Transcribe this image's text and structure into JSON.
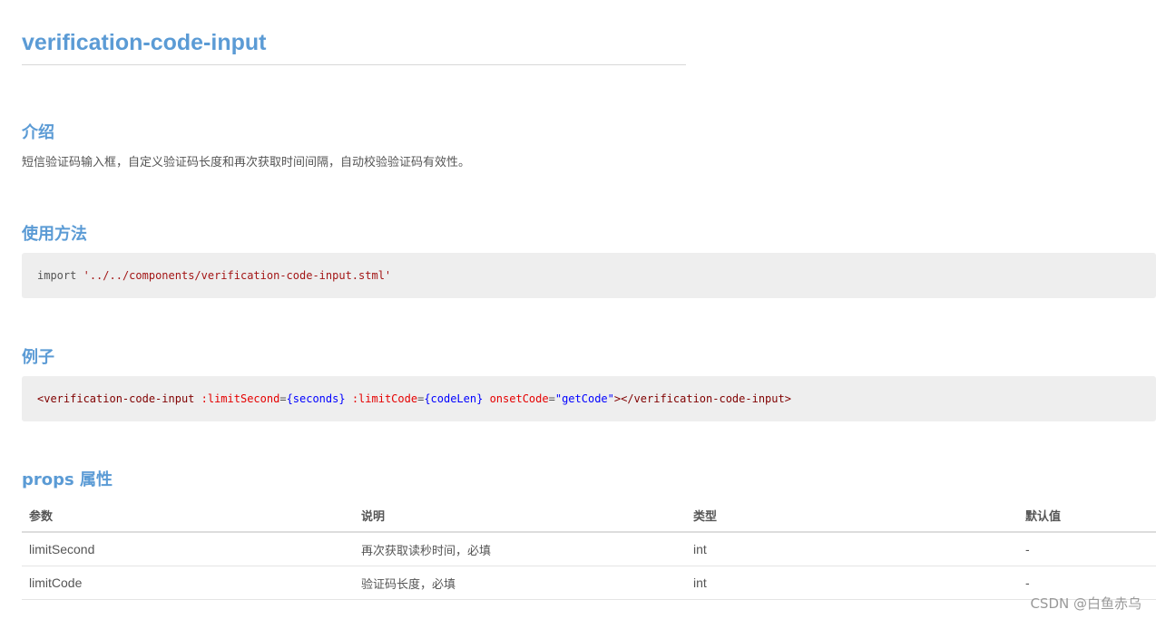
{
  "page": {
    "title": "verification-code-input"
  },
  "intro": {
    "heading": "介绍",
    "text": "短信验证码输入框，自定义验证码长度和再次获取时间间隔，自动校验验证码有效性。"
  },
  "usage": {
    "heading": "使用方法",
    "code_keyword": "import",
    "code_string": "'../../components/verification-code-input.stml'"
  },
  "example": {
    "heading": "例子",
    "open_tag": "<verification-code-input",
    "attr1_name": ":limitSecond",
    "attr1_value": "{seconds}",
    "attr2_name": ":limitCode",
    "attr2_value": "{codeLen}",
    "attr3_name": "onsetCode",
    "attr3_value": "\"getCode\"",
    "close_tag": "></verification-code-input>"
  },
  "props": {
    "heading": "props 属性",
    "columns": [
      "参数",
      "说明",
      "类型",
      "默认值"
    ],
    "rows": [
      [
        "limitSecond",
        "再次获取读秒时间，必填",
        "int",
        "-"
      ],
      [
        "limitCode",
        "验证码长度，必填",
        "int",
        "-"
      ]
    ]
  },
  "watermark": "CSDN @白鱼赤乌",
  "colors": {
    "heading": "#5b9bd5",
    "code_bg": "#eeeeee",
    "string": "#a31515",
    "attribute": "#e50000",
    "value": "#0000ff"
  }
}
